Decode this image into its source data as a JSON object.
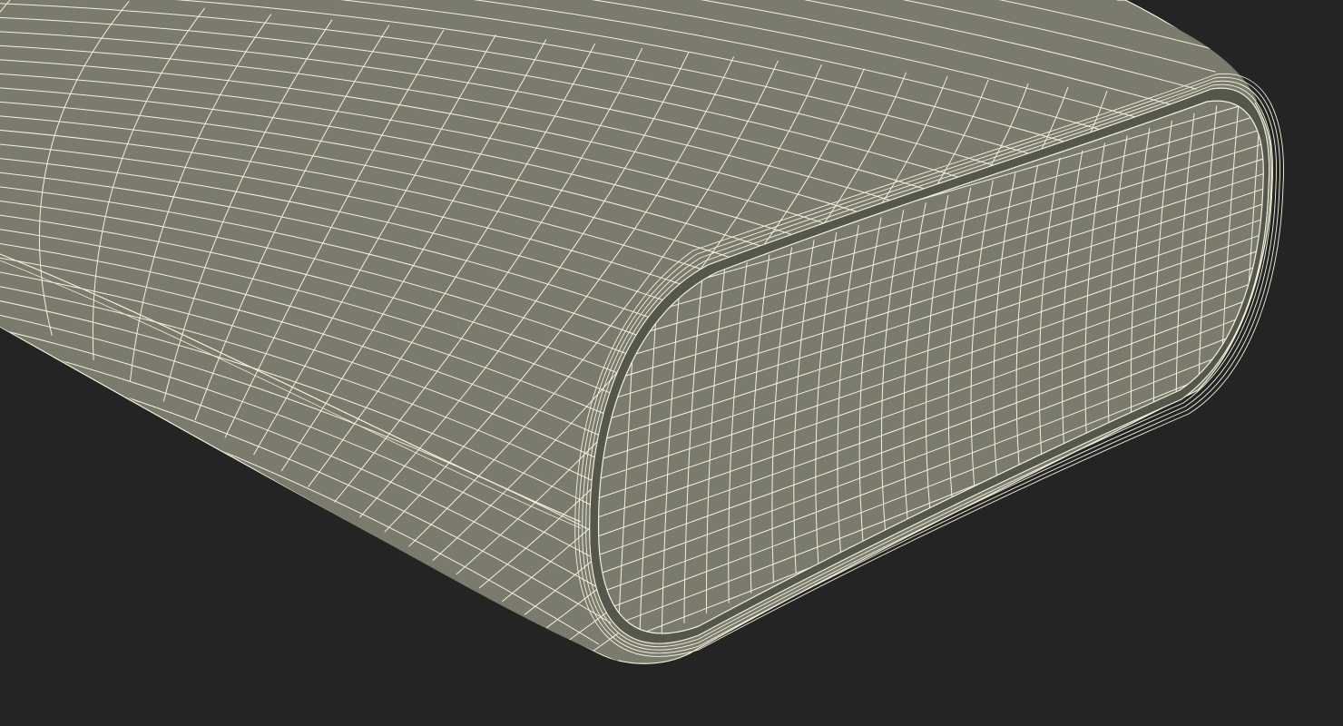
{
  "scene": {
    "subject": "wireframe-mesh",
    "colors": {
      "background": "#242424",
      "surface": "#7a7b6d",
      "surface_shade": "#6f7064",
      "recess": "#55564c",
      "wire": "#f4f1de"
    }
  }
}
